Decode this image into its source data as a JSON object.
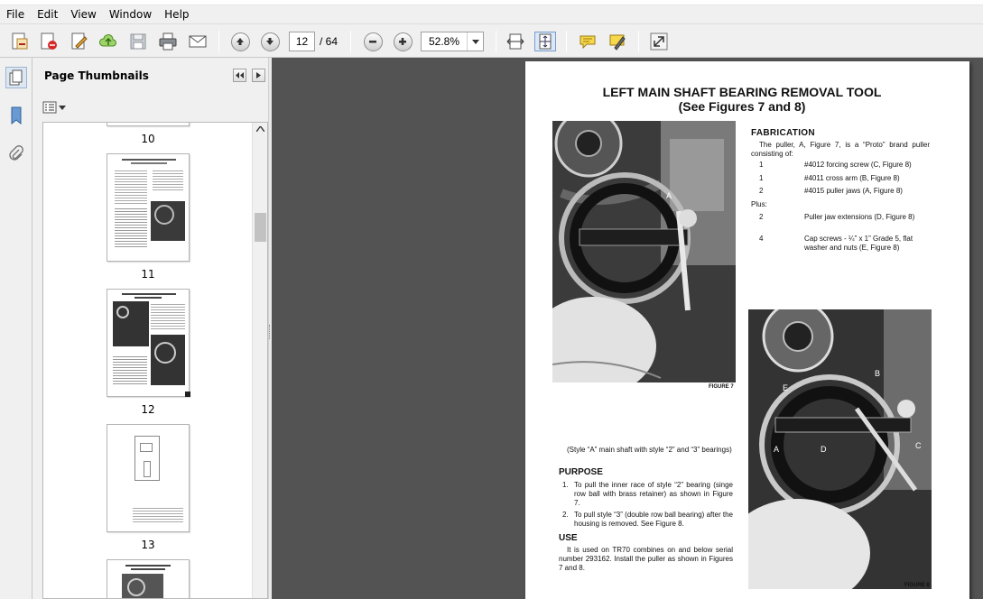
{
  "menu": [
    "File",
    "Edit",
    "View",
    "Window",
    "Help"
  ],
  "toolbar": {
    "page_current": "12",
    "page_total": "/ 64",
    "zoom": "52.8%",
    "icons": [
      "create-pdf-icon",
      "convert-pdf-icon",
      "edit-pdf-icon",
      "upload-cloud-icon",
      "save-icon",
      "print-icon",
      "email-icon",
      "previous-page-icon",
      "next-page-icon",
      "zoom-out-icon",
      "zoom-in-icon",
      "fit-width-icon",
      "fit-page-icon",
      "comment-icon",
      "highlight-icon",
      "expand-icon"
    ]
  },
  "panel": {
    "title": "Page Thumbnails",
    "thumbnails": [
      {
        "label": "10"
      },
      {
        "label": "11"
      },
      {
        "label": "12"
      },
      {
        "label": "13"
      }
    ]
  },
  "document": {
    "title": "LEFT MAIN SHAFT BEARING REMOVAL TOOL",
    "subtitle": "(See Figures 7 and 8)",
    "fabrication": {
      "heading": "FABRICATION",
      "intro": "The puller, A, Figure 7, is a “Proto” brand puller consisting of:",
      "items": [
        {
          "qty": "1",
          "part": "#4012 forcing screw (C, Figure 8)"
        },
        {
          "qty": "1",
          "part": "#4011 cross arm (B, Figure 8)"
        },
        {
          "qty": "2",
          "part": "#4015 puller jaws (A, Figure 8)"
        }
      ],
      "plus_label": "Plus:",
      "plus_items": [
        {
          "qty": "2",
          "part": "Puller jaw extensions (D, Figure 8)"
        },
        {
          "qty": "4",
          "part": "Cap screws - ¼” x 1” Grade 5, flat washer and nuts (E, Figure 8)"
        }
      ]
    },
    "figure7_caption": "FIGURE 7",
    "figure8_caption": "FIGURE 8",
    "style_note": "(Style “A” main shaft with style “2” and “3” bearings)",
    "purpose": {
      "heading": "PURPOSE",
      "items": [
        {
          "num": "1.",
          "text": "To pull the inner race of style “2” bearing (singe row ball with brass retainer) as shown in Figure 7."
        },
        {
          "num": "2.",
          "text": "To pull style “3” (double row ball bearing) after the housing is removed. See Figure 8."
        }
      ]
    },
    "use": {
      "heading": "USE",
      "text": "It is used on TR70 combines on and below serial number 293162. Install the puller as shown in Figures 7 and 8."
    },
    "figure7_labels": [
      "A"
    ],
    "figure8_labels": [
      "B",
      "E",
      "A",
      "D",
      "C"
    ]
  }
}
